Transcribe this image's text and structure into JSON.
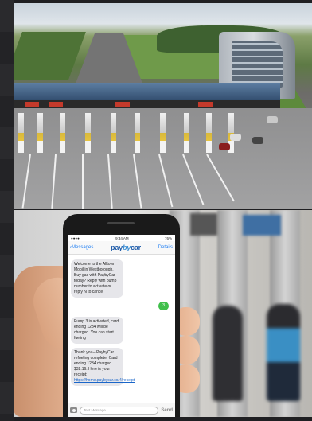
{
  "status_bar": {
    "time": "9:34 AM",
    "battery": "76%"
  },
  "nav": {
    "back_label": "Messages",
    "details_label": "Details"
  },
  "logo": {
    "pay": "pay",
    "by": "by",
    "car": "car"
  },
  "messages": [
    {
      "from": "received",
      "text": "Welcome to the Alltown Mobil in Westborough. Buy gas with PaybyCar today? Reply with pump number to activate or reply N to cancel"
    },
    {
      "from": "sent",
      "text": "3"
    },
    {
      "from": "received",
      "text": "Pump 3 is activated, card ending 1234 will be charged. You can start fueling"
    },
    {
      "from": "received",
      "text": "Thank you-- PaybyCar refueling complete. Card ending 1234 charged $32.16. Here is your receipt:",
      "link": "https://home.paybycar.co/4/receipt"
    }
  ],
  "composer": {
    "placeholder": "Text Message",
    "send_label": "Send"
  },
  "icons": {
    "back": "chevron-left-icon",
    "camera": "camera-icon"
  },
  "colors": {
    "ios_blue": "#1a7bf2",
    "sent_green": "#3fbf4a",
    "brand_blue": "#1d5aa8"
  }
}
